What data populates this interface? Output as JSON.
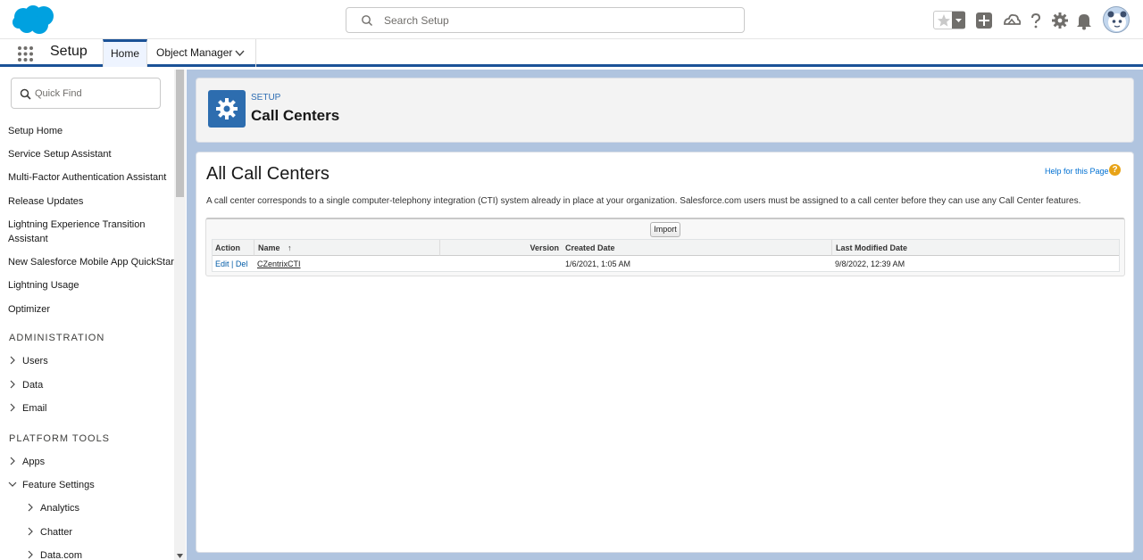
{
  "header": {
    "search_placeholder": "Search Setup",
    "brand_color": "#00a1e0"
  },
  "context_bar": {
    "app_name": "Setup",
    "tabs": [
      {
        "label": "Home",
        "active": true
      },
      {
        "label": "Object Manager",
        "active": false
      }
    ]
  },
  "sidebar": {
    "quickfind_placeholder": "Quick Find",
    "links": [
      "Setup Home",
      "Service Setup Assistant",
      "Multi-Factor Authentication Assistant",
      "Release Updates",
      "Lightning Experience Transition",
      "Assistant",
      "New Salesforce Mobile App QuickStart",
      "Lightning Usage",
      "Optimizer"
    ],
    "sections": [
      {
        "title": "ADMINISTRATION",
        "items": [
          "Users",
          "Data",
          "Email"
        ]
      },
      {
        "title": "PLATFORM TOOLS",
        "items": [
          "Apps",
          "Feature Settings"
        ]
      }
    ],
    "feature_settings_children": [
      "Analytics",
      "Chatter",
      "Data.com"
    ]
  },
  "page_header": {
    "eyebrow": "SETUP",
    "title": "Call Centers"
  },
  "main": {
    "title": "All Call Centers",
    "help_link": "Help for this Page",
    "help_icon": "?",
    "description": "A call center corresponds to a single computer-telephony integration (CTI) system already in place at your organization. Salesforce.com users must be assigned to a call center before they can use any Call Center features.",
    "import_label": "Import",
    "table": {
      "headers": {
        "action": "Action",
        "name": "Name",
        "sort_indicator": "↑",
        "version": "Version",
        "created": "Created Date",
        "modified": "Last Modified Date"
      },
      "rows": [
        {
          "edit": "Edit",
          "sep": "|",
          "del": "Del",
          "name": "CZentrixCTI",
          "version": "",
          "created": "1/6/2021, 1:05 AM",
          "modified": "9/8/2022, 12:39 AM"
        }
      ]
    }
  }
}
